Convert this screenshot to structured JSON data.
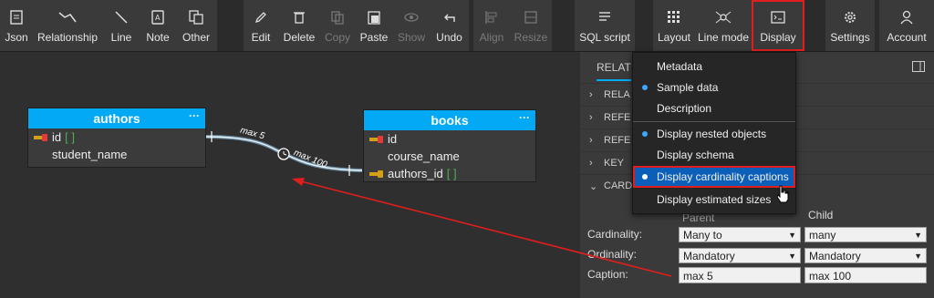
{
  "toolbar": {
    "groups": [
      [
        {
          "label": "Json",
          "icon": "json-icon",
          "enabled": true
        },
        {
          "label": "Relationship",
          "icon": "relationship-icon",
          "enabled": true
        },
        {
          "label": "Line",
          "icon": "line-icon",
          "enabled": true
        },
        {
          "label": "Note",
          "icon": "note-icon",
          "enabled": true
        },
        {
          "label": "Other",
          "icon": "other-icon",
          "enabled": true
        }
      ],
      [
        {
          "label": "Edit",
          "icon": "edit-icon",
          "enabled": true
        },
        {
          "label": "Delete",
          "icon": "delete-icon",
          "enabled": true
        },
        {
          "label": "Copy",
          "icon": "copy-icon",
          "enabled": false
        },
        {
          "label": "Paste",
          "icon": "paste-icon",
          "enabled": true
        },
        {
          "label": "Show",
          "icon": "show-icon",
          "enabled": false
        },
        {
          "label": "Undo",
          "icon": "undo-icon",
          "enabled": true
        }
      ],
      [
        {
          "label": "Align",
          "icon": "align-icon",
          "enabled": false
        },
        {
          "label": "Resize",
          "icon": "resize-icon",
          "enabled": false
        }
      ],
      [
        {
          "label": "SQL script",
          "icon": "sql-script-icon",
          "enabled": true
        }
      ],
      [
        {
          "label": "Layout",
          "icon": "layout-icon",
          "enabled": true
        },
        {
          "label": "Line mode",
          "icon": "line-mode-icon",
          "enabled": true
        },
        {
          "label": "Display",
          "icon": "display-icon",
          "enabled": true,
          "active": true
        }
      ],
      [
        {
          "label": "Settings",
          "icon": "settings-icon",
          "enabled": true
        }
      ],
      [
        {
          "label": "Account",
          "icon": "account-icon",
          "enabled": true
        }
      ]
    ]
  },
  "diagram": {
    "entities": [
      {
        "name": "authors",
        "rows": [
          {
            "text": "id",
            "key": "pk",
            "nn": "[ ]"
          },
          {
            "text": "student_name"
          }
        ]
      },
      {
        "name": "books",
        "rows": [
          {
            "text": "id",
            "key": "pk"
          },
          {
            "text": "course_name"
          },
          {
            "text": "authors_id",
            "key": "fk",
            "nn": "[ ]"
          }
        ]
      }
    ],
    "relationship": {
      "parent_caption": "max 5",
      "child_caption": "max 100"
    }
  },
  "panel": {
    "tab": "RELAT",
    "sections": [
      "RELA",
      "REFE",
      "REFE",
      "KEY",
      "CARD"
    ],
    "col_parent": "Parent",
    "col_child": "Child",
    "cardinality_label": "Cardinality:",
    "cardinality_parent": "Many to",
    "cardinality_child": "many",
    "ordinality_label": "Ordinality:",
    "ordinality_parent": "Mandatory",
    "ordinality_child": "Mandatory",
    "caption_label": "Caption:",
    "caption_parent": "max 5",
    "caption_child": "max 100"
  },
  "display_menu": {
    "items": [
      {
        "label": "Metadata",
        "checked": false
      },
      {
        "label": "Sample data",
        "checked": true
      },
      {
        "label": "Description",
        "checked": false
      },
      {
        "label": "Display nested objects",
        "checked": true
      },
      {
        "label": "Display schema",
        "checked": false
      },
      {
        "label": "Display cardinality captions",
        "checked": true,
        "highlighted": true
      },
      {
        "label": "Display estimated sizes",
        "checked": false
      }
    ]
  },
  "colors": {
    "accent": "#03a9f4",
    "highlight": "#0b5fb8",
    "annotation": "#e01e1e",
    "nn": "#4caf50"
  }
}
